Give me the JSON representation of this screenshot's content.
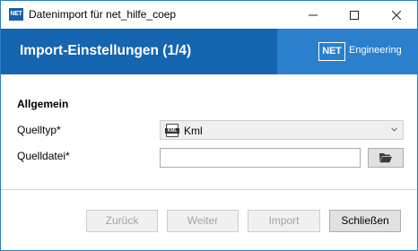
{
  "window": {
    "icon_text": "NET",
    "title": "Datenimport für net_hilfe_coep",
    "controls": [
      "minimize-icon",
      "maximize-icon",
      "close-icon"
    ]
  },
  "banner": {
    "title": "Import-Einstellungen (1/4)",
    "brand_mark": "NET",
    "brand_name": "Engineering",
    "colors": {
      "primary": "#1565b0",
      "secondary": "#2a80cc"
    }
  },
  "form": {
    "section_title": "Allgemein",
    "source_type": {
      "label": "Quelltyp*",
      "icon": "kml-file-icon",
      "icon_tag": "KML",
      "value": "Kml"
    },
    "source_file": {
      "label": "Quelldatei*",
      "value": "",
      "placeholder": "",
      "browse_icon": "folder-open-icon"
    }
  },
  "footer": {
    "back_label": "Zurück",
    "next_label": "Weiter",
    "import_label": "Import",
    "close_label": "Schließen",
    "disabled_buttons": [
      "back",
      "next",
      "import"
    ]
  }
}
